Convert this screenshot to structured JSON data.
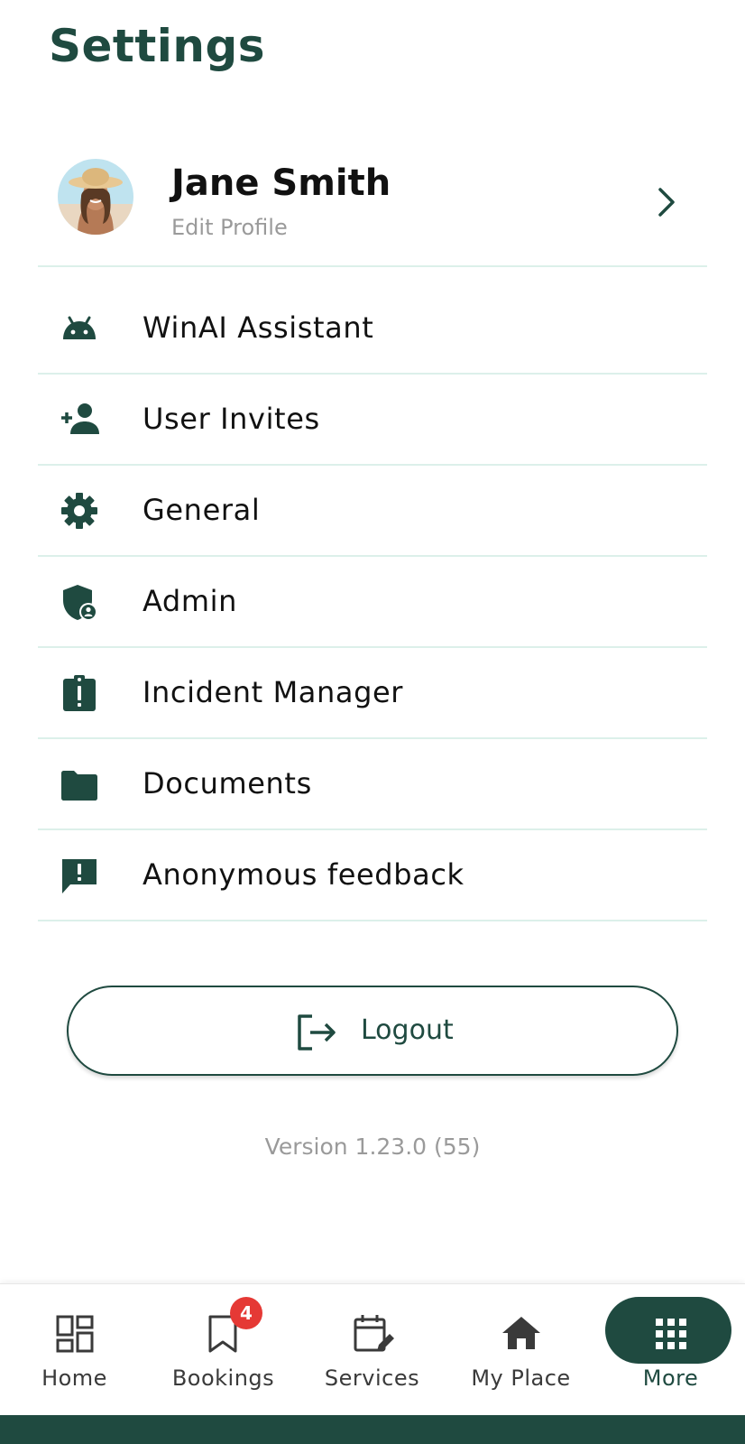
{
  "page": {
    "title": "Settings"
  },
  "profile": {
    "name": "Jane Smith",
    "subtitle": "Edit Profile"
  },
  "menu": {
    "items": [
      {
        "label": "WinAI Assistant",
        "icon": "android-icon"
      },
      {
        "label": "User Invites",
        "icon": "person-add-icon"
      },
      {
        "label": "General",
        "icon": "gear-icon"
      },
      {
        "label": "Admin",
        "icon": "admin-shield-icon"
      },
      {
        "label": "Incident Manager",
        "icon": "clipboard-alert-icon"
      },
      {
        "label": "Documents",
        "icon": "folder-icon"
      },
      {
        "label": "Anonymous feedback",
        "icon": "feedback-icon"
      }
    ]
  },
  "logout": {
    "label": "Logout",
    "icon": "logout-icon"
  },
  "version": {
    "text": "Version 1.23.0 (55)"
  },
  "bottom_nav": {
    "items": [
      {
        "label": "Home",
        "icon": "dashboard-icon"
      },
      {
        "label": "Bookings",
        "icon": "bookmark-icon",
        "badge": "4"
      },
      {
        "label": "Services",
        "icon": "calendar-edit-icon"
      },
      {
        "label": "My Place",
        "icon": "house-icon"
      },
      {
        "label": "More",
        "icon": "grid-icon",
        "active": true
      }
    ]
  },
  "colors": {
    "accent": "#1f4a40",
    "divider": "#dcf0ea",
    "badge": "#e53935",
    "muted": "#9a9a9a"
  }
}
